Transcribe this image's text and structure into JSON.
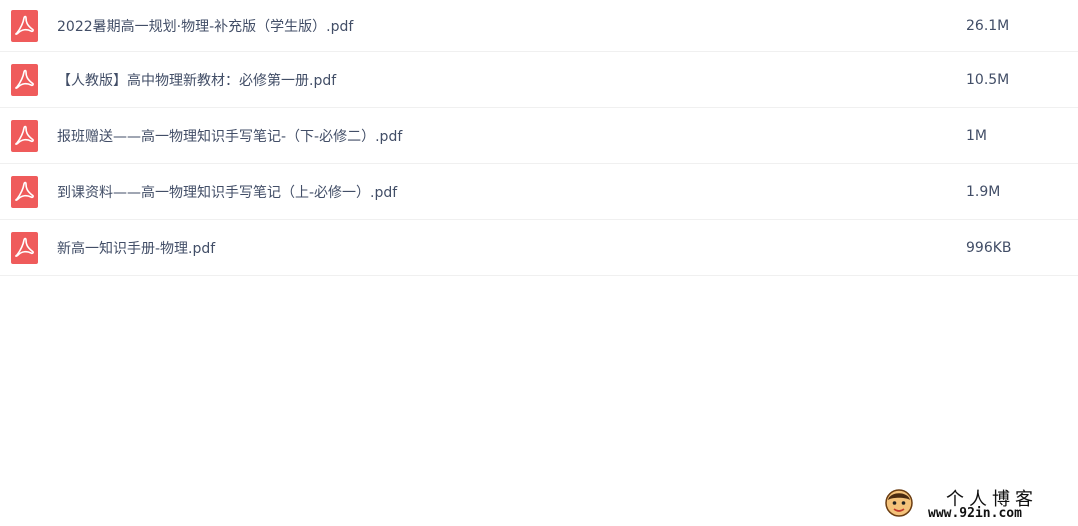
{
  "files": [
    {
      "name": "2022暑期高一规划·物理-补充版（学生版）.pdf",
      "size": "26.1M",
      "icon": "pdf-icon"
    },
    {
      "name": "【人教版】高中物理新教材：必修第一册.pdf",
      "size": "10.5M",
      "icon": "pdf-icon"
    },
    {
      "name": "报班赠送——高一物理知识手写笔记-（下-必修二）.pdf",
      "size": "1M",
      "icon": "pdf-icon"
    },
    {
      "name": "到课资料——高一物理知识手写笔记（上-必修一）.pdf",
      "size": "1.9M",
      "icon": "pdf-icon"
    },
    {
      "name": "新高一知识手册-物理.pdf",
      "size": "996KB",
      "icon": "pdf-icon"
    }
  ],
  "watermark": {
    "title": "个人博客",
    "url": "www.92in.com"
  },
  "colors": {
    "pdf_icon": "#ef5b5b",
    "text": "#424e67",
    "divider": "#f0f0f0"
  }
}
